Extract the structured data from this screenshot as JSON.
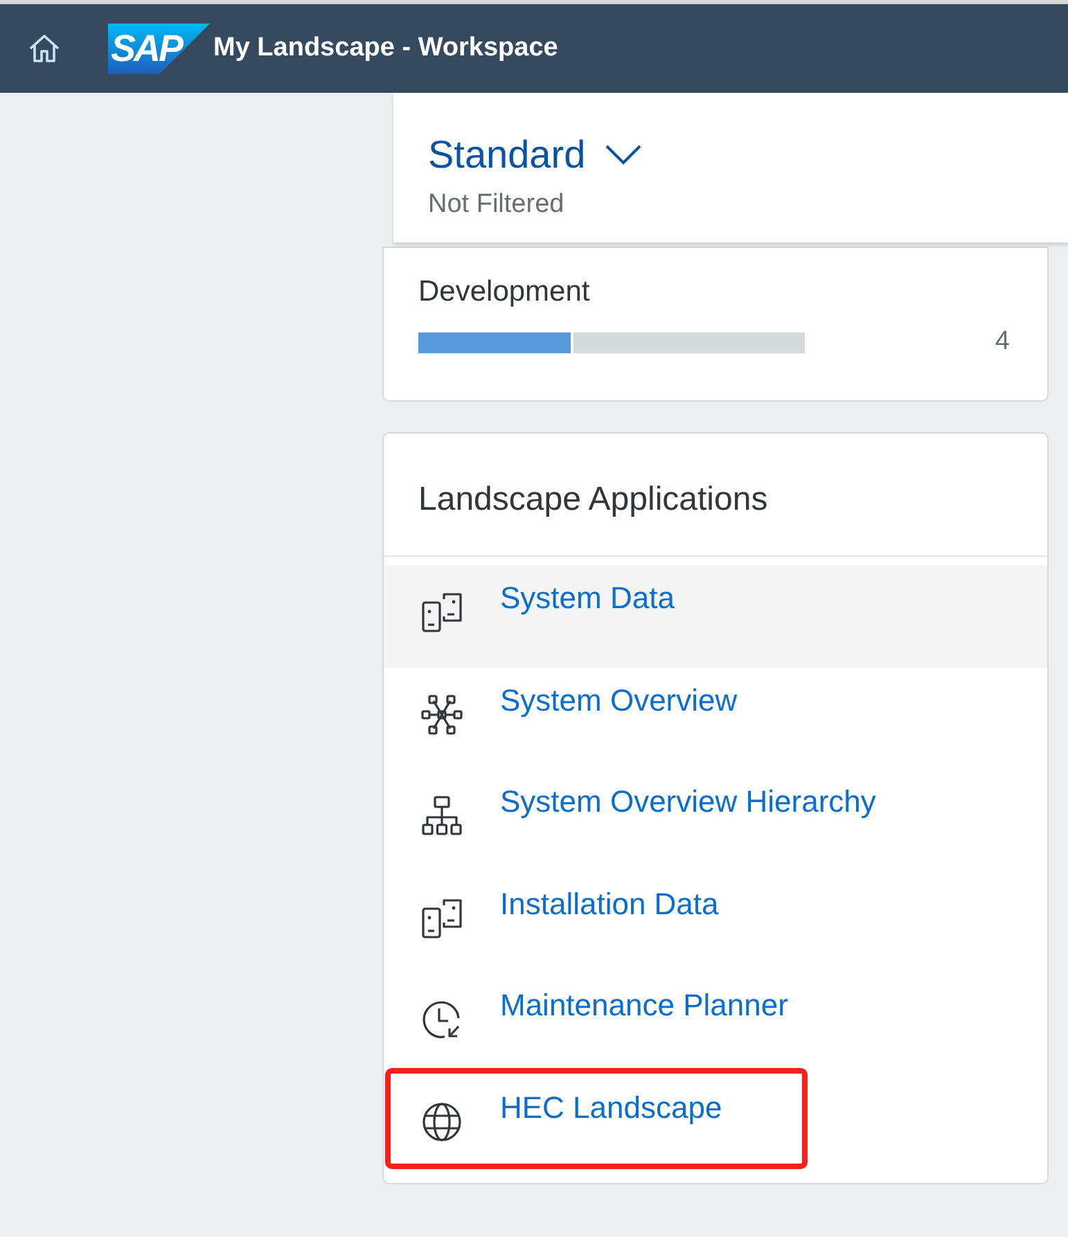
{
  "shell_bar": {
    "logo": "SAP",
    "title": "My Landscape - Workspace"
  },
  "variant": {
    "name": "Standard",
    "filter_status": "Not Filtered"
  },
  "summary_card": {
    "title": "Development",
    "level": 0.4,
    "count": "4"
  },
  "applications": {
    "title": "Landscape Applications",
    "items": [
      {
        "kind": "data",
        "label": "System Data",
        "hovered": true,
        "annotated": false
      },
      {
        "kind": "overview",
        "label": "System Overview",
        "hovered": false,
        "annotated": false
      },
      {
        "kind": "hierarchy",
        "label": "System Overview Hierarchy",
        "hovered": false,
        "annotated": false
      },
      {
        "kind": "data",
        "label": "Installation Data",
        "hovered": false,
        "annotated": false
      },
      {
        "kind": "planner",
        "label": "Maintenance Planner",
        "hovered": false,
        "annotated": false
      },
      {
        "kind": "web",
        "label": "HEC Landscape",
        "hovered": false,
        "annotated": true
      }
    ]
  }
}
